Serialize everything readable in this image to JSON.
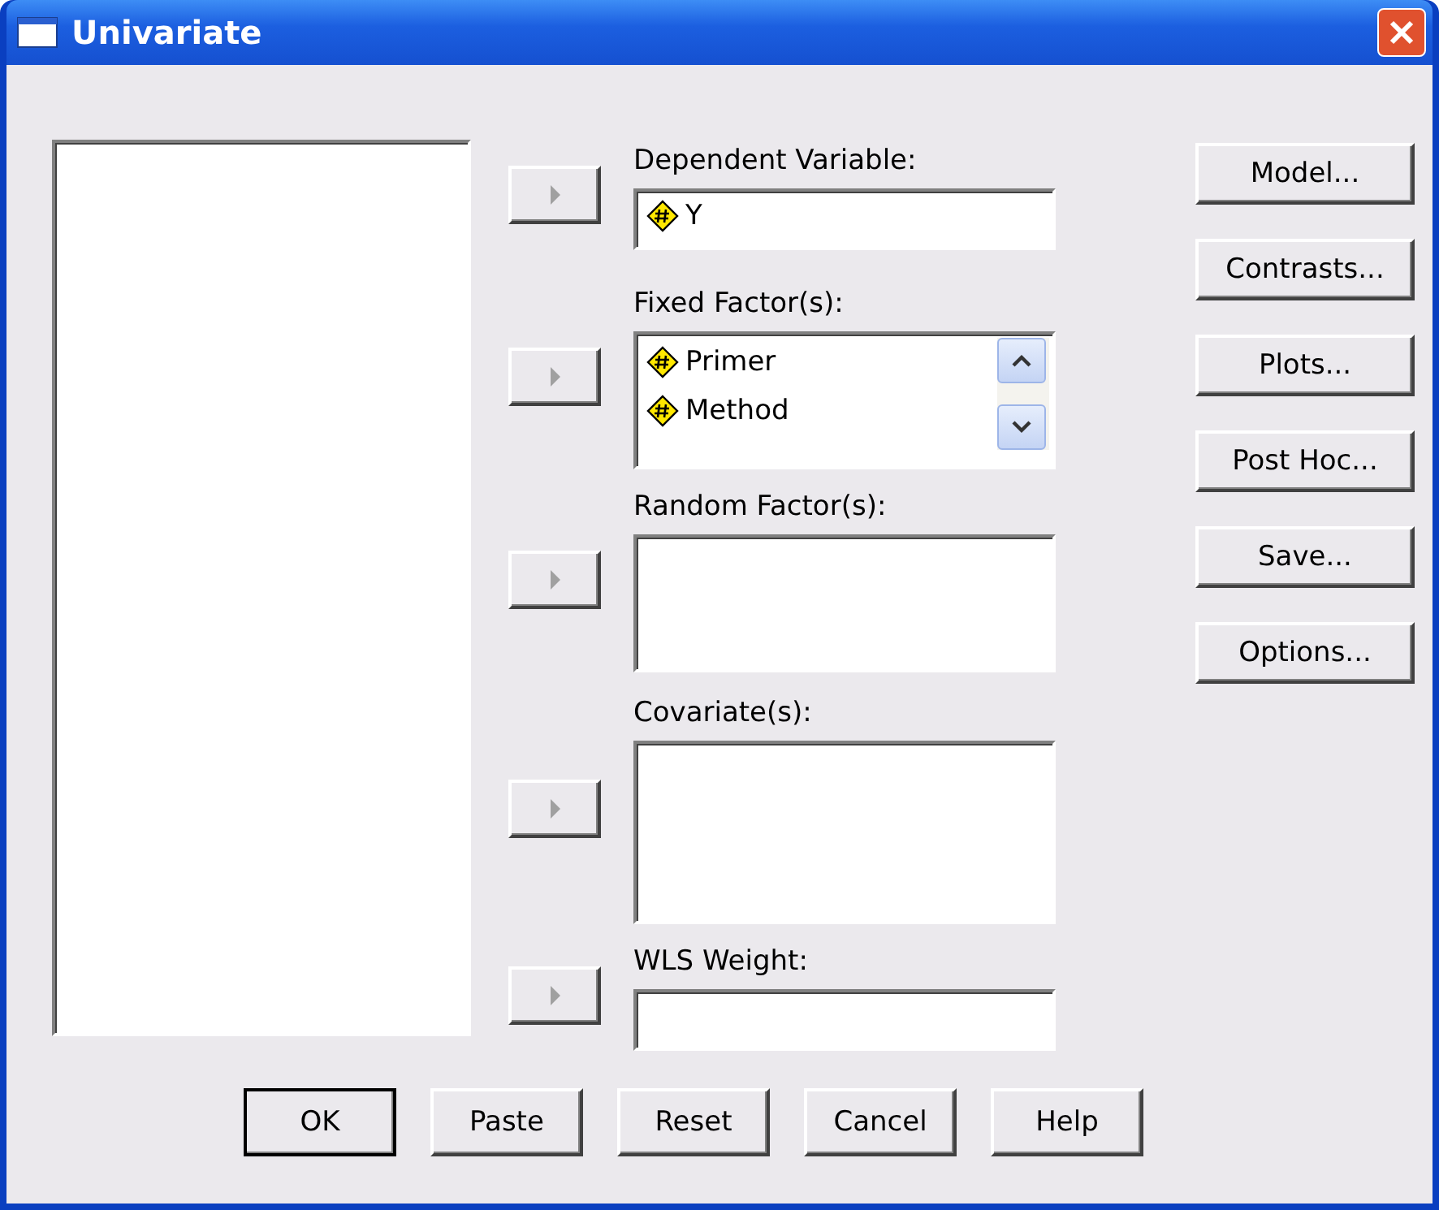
{
  "window": {
    "title": "Univariate"
  },
  "targets": [
    {
      "label": "Dependent Variable:",
      "kind": "field",
      "items": [
        {
          "name": "Y"
        }
      ]
    },
    {
      "label": "Fixed Factor(s):",
      "kind": "list",
      "items": [
        {
          "name": "Primer"
        },
        {
          "name": "Method"
        }
      ]
    },
    {
      "label": "Random Factor(s):",
      "kind": "list"
    },
    {
      "label": "Covariate(s):",
      "kind": "list"
    },
    {
      "label": "WLS Weight:",
      "kind": "field"
    }
  ],
  "side_buttons": [
    {
      "label": "Model..."
    },
    {
      "label": "Contrasts..."
    },
    {
      "label": "Plots..."
    },
    {
      "label": "Post Hoc..."
    },
    {
      "label": "Save..."
    },
    {
      "label": "Options..."
    }
  ],
  "bottom_buttons": [
    {
      "label": "OK",
      "default": true
    },
    {
      "label": "Paste",
      "default": false
    },
    {
      "label": "Reset",
      "default": false
    },
    {
      "label": "Cancel",
      "default": false
    },
    {
      "label": "Help",
      "default": false
    }
  ]
}
